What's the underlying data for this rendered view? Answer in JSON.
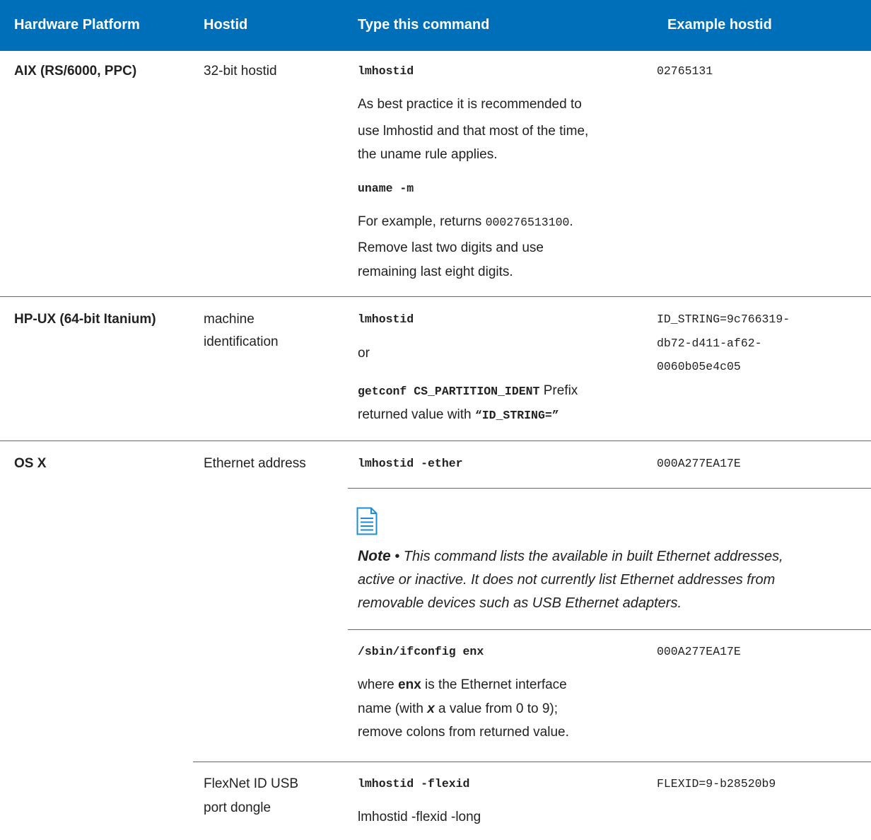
{
  "header": {
    "col1": "Hardware Platform",
    "col2": "Hostid",
    "col3": "Type this command",
    "col4": "Example hostid"
  },
  "rows": {
    "aix": {
      "platform": "AIX (RS/6000, PPC)",
      "hostid": "32-bit hostid",
      "cmd1": "lmhostid",
      "para1_l1": "As best practice it is recommended to",
      "para1_l2": "use lmhostid and that most of the time,",
      "para1_l3": "the uname rule applies.",
      "cmd2": "uname -m",
      "para2_l1a": "For example, returns ",
      "para2_l1b": "000276513100",
      "para2_l1c": ".",
      "para2_l2": "Remove last two digits and use",
      "para2_l3": "remaining last eight digits.",
      "example": "02765131"
    },
    "hpux": {
      "platform": "HP-UX (64-bit Itanium)",
      "hostid_l1": "machine",
      "hostid_l2": "identification",
      "cmd1": "lmhostid",
      "or": "or",
      "cmd2": "getconf CS_PARTITION_IDENT",
      "cmd2_tail": " Prefix",
      "para_l2a": "returned value with ",
      "para_l2b": "“ID_STRING=”",
      "example_l1": "ID_STRING=9c766319-",
      "example_l2": "db72-d411-af62-",
      "example_l3": "0060b05e4c05"
    },
    "osx": {
      "platform": "OS X",
      "hostid": "Ethernet address",
      "cmd1": "lmhostid -ether",
      "example1": "000A277EA17E",
      "note_label": "Note",
      "note_bullet": " • ",
      "note_l1": "This command lists the available in built Ethernet addresses,",
      "note_l2": "active or inactive. It does not currently list Ethernet addresses from",
      "note_l3": "removable devices such as USB Ethernet adapters.",
      "cmd2": "/sbin/ifconfig enx",
      "example2": "000A277EA17E",
      "para_l1a": "where ",
      "para_l1b": "enx",
      "para_l1c": " is the Ethernet interface",
      "para_l2a": "name (with ",
      "para_l2b": "x",
      "para_l2c": " a value from 0 to 9);",
      "para_l3": "remove colons from returned value."
    },
    "flexnet": {
      "hostid_l1": "FlexNet ID USB",
      "hostid_l2": "port dongle",
      "cmd1": "lmhostid -flexid",
      "cmd2": "lmhostid -flexid -long",
      "example": "FLEXID=9-b28520b9"
    }
  },
  "icons": {
    "note": "document-note-icon"
  },
  "colors": {
    "header_bg": "#006fba",
    "note_icon": "#1a8fd6",
    "rule": "#666666"
  }
}
